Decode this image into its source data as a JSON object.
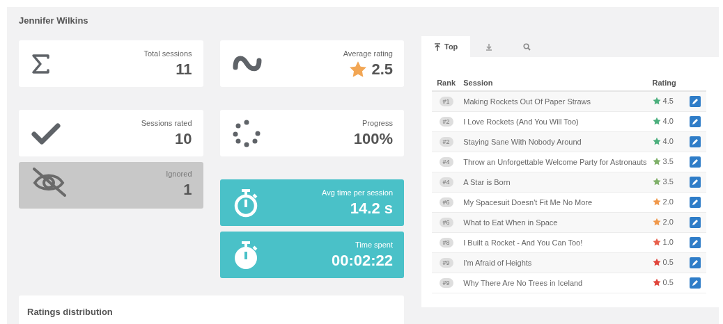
{
  "header": {
    "title": "Jennifer Wilkins"
  },
  "stats_left": [
    {
      "kind": "plain",
      "label": "Total sessions",
      "value": "11"
    },
    {
      "kind": "plain",
      "label": "Sessions rated",
      "value": "10"
    },
    {
      "kind": "muted",
      "label": "Ignored",
      "value": "1"
    }
  ],
  "stats_right": [
    {
      "kind": "plain",
      "label": "Average rating",
      "value": "2.5",
      "star": true
    },
    {
      "kind": "plain",
      "label": "Progress",
      "value": "100%"
    },
    {
      "kind": "accent",
      "label": "Avg time per session",
      "value": "14.2 s"
    },
    {
      "kind": "accent",
      "label": "Time spent",
      "value": "00:02:22"
    }
  ],
  "distribution": {
    "title": "Ratings distribution"
  },
  "tabs": [
    {
      "label": "Top",
      "selected": true
    },
    {
      "selected": false
    },
    {
      "selected": false
    }
  ],
  "table": {
    "columns": [
      "Rank",
      "Session",
      "Rating"
    ],
    "rows": [
      {
        "rank": "#1",
        "session": "Making Rockets Out Of Paper Straws",
        "rating": "4.5",
        "color": "#4caf7d"
      },
      {
        "rank": "#2",
        "session": "I Love Rockets (And You Will Too)",
        "rating": "4.0",
        "color": "#4caf7d"
      },
      {
        "rank": "#2",
        "session": "Staying Sane With Nobody Around",
        "rating": "4.0",
        "color": "#4caf7d"
      },
      {
        "rank": "#4",
        "session": "Throw an Unforgettable Welcome Party for Astronauts",
        "rating": "3.5",
        "color": "#7fb069"
      },
      {
        "rank": "#4",
        "session": "A Star is Born",
        "rating": "3.5",
        "color": "#7fb069"
      },
      {
        "rank": "#6",
        "session": "My Spacesuit Doesn't Fit Me No More",
        "rating": "2.0",
        "color": "#f0984b"
      },
      {
        "rank": "#6",
        "session": "What to Eat When in Space",
        "rating": "2.0",
        "color": "#f0984b"
      },
      {
        "rank": "#8",
        "session": "I Built a Rocket - And You Can Too!",
        "rating": "1.0",
        "color": "#e8604c"
      },
      {
        "rank": "#9",
        "session": "I'm Afraid of Heights",
        "rating": "0.5",
        "color": "#e0463c"
      },
      {
        "rank": "#9",
        "session": "Why There Are No Trees in Iceland",
        "rating": "0.5",
        "color": "#e0463c"
      }
    ]
  }
}
